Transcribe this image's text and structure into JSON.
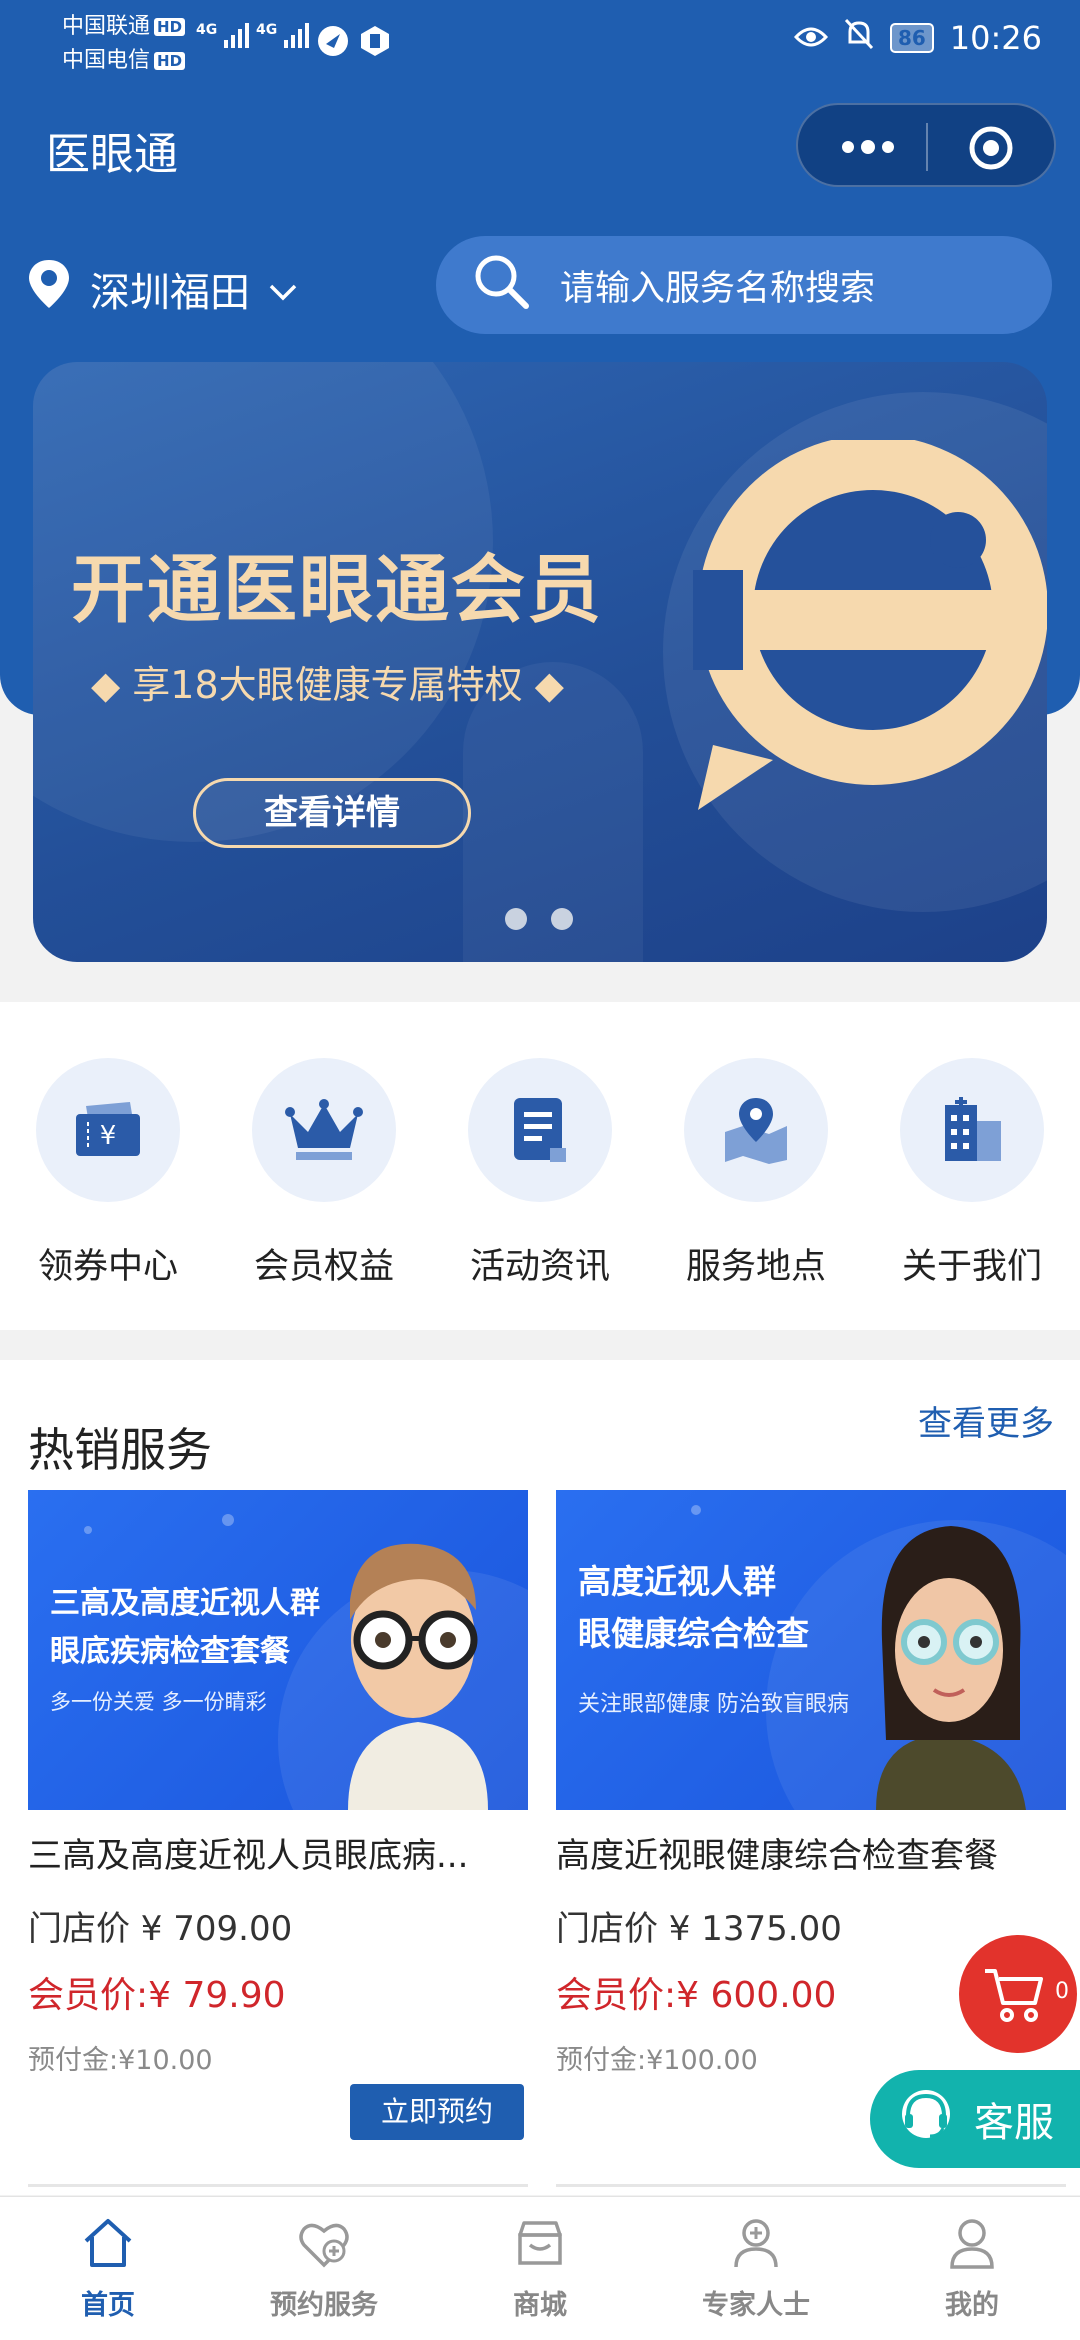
{
  "status_bar": {
    "carrier1": "中国联通",
    "carrier2": "中国电信",
    "hd": "HD",
    "signal1": "4G",
    "signal2": "4G",
    "battery": "86",
    "time": "10:26"
  },
  "header": {
    "app_title": "医眼通",
    "location": "深圳福田",
    "search_placeholder": "请输入服务名称搜索"
  },
  "banner": {
    "title": "开通医眼通会员",
    "subtitle": "◆ 享18大眼健康专属特权 ◆",
    "button": "查看详情",
    "page_count": 2,
    "active_page": 0
  },
  "quick_links": [
    {
      "label": "领券中心",
      "icon": "coupon-icon"
    },
    {
      "label": "会员权益",
      "icon": "crown-icon"
    },
    {
      "label": "活动资讯",
      "icon": "document-icon"
    },
    {
      "label": "服务地点",
      "icon": "map-pin-icon"
    },
    {
      "label": "关于我们",
      "icon": "building-icon"
    }
  ],
  "hot_services": {
    "title": "热销服务",
    "more": "查看更多",
    "items": [
      {
        "image_line1": "三高及高度近视人群",
        "image_line2": "眼底疾病检查套餐",
        "image_tagline": "多一份关爱 多一份睛彩",
        "name": "三高及高度近视人员眼底病...",
        "store_price": "门店价 ¥ 709.00",
        "member_price": "会员价:¥ 79.90",
        "deposit": "预付金:¥10.00"
      },
      {
        "image_line1": "高度近视人群",
        "image_line2": "眼健康综合检查",
        "image_tagline": "关注眼部健康 防治致盲眼病",
        "name": "高度近视眼健康综合检查套餐",
        "store_price": "门店价 ¥ 1375.00",
        "member_price": "会员价:¥ 600.00",
        "deposit": "预付金:¥100.00"
      }
    ],
    "book_button": "立即预约"
  },
  "floating": {
    "cart_count": "0",
    "customer_service": "客服"
  },
  "tabbar": [
    {
      "label": "首页",
      "icon": "home-icon",
      "active": true
    },
    {
      "label": "预约服务",
      "icon": "appointment-icon",
      "active": false
    },
    {
      "label": "商城",
      "icon": "shop-icon",
      "active": false
    },
    {
      "label": "专家人士",
      "icon": "doctor-icon",
      "active": false
    },
    {
      "label": "我的",
      "icon": "user-icon",
      "active": false
    }
  ],
  "colors": {
    "primary": "#1f5eb0",
    "accent_gold": "#f6d9ae",
    "price_red": "#d0262b",
    "cart_red": "#e2332c",
    "service_teal": "#12b3ad"
  }
}
